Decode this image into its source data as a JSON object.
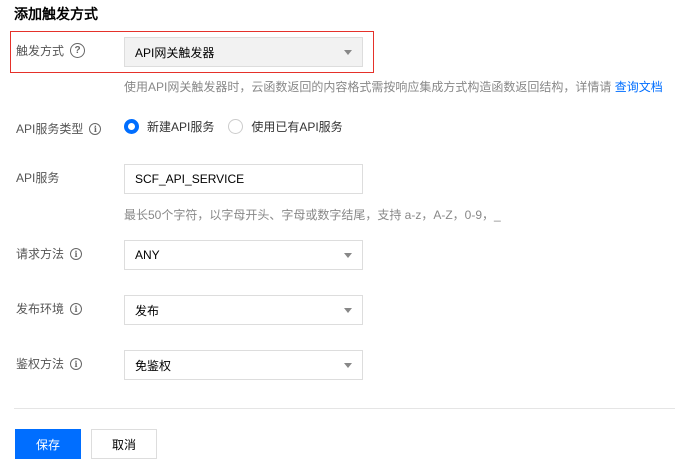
{
  "form": {
    "title": "添加触发方式",
    "trigger": {
      "label": "触发方式",
      "help_icon": "question-circle-icon",
      "value": "API网关触发器",
      "hint_text": "使用API网关触发器时，云函数返回的内容格式需按响应集成方式构造函数返回结构，详情请",
      "hint_link": "查询文档"
    },
    "service_type": {
      "label": "API服务类型",
      "info_icon": "info-circle-icon",
      "options": [
        "新建API服务",
        "使用已有API服务"
      ],
      "selected": "新建API服务"
    },
    "api_service": {
      "label": "API服务",
      "value": "SCF_API_SERVICE",
      "hint": "最长50个字符，以字母开头、字母或数字结尾，支持 a-z，A-Z，0-9，_"
    },
    "method": {
      "label": "请求方法",
      "info_icon": "info-circle-icon",
      "value": "ANY"
    },
    "environment": {
      "label": "发布环境",
      "info_icon": "info-circle-icon",
      "value": "发布"
    },
    "auth": {
      "label": "鉴权方法",
      "info_icon": "info-circle-icon",
      "value": "免鉴权"
    }
  },
  "actions": {
    "save": "保存",
    "cancel": "取消"
  },
  "colors": {
    "primary": "#006eff",
    "highlight_border": "#e5312a"
  }
}
